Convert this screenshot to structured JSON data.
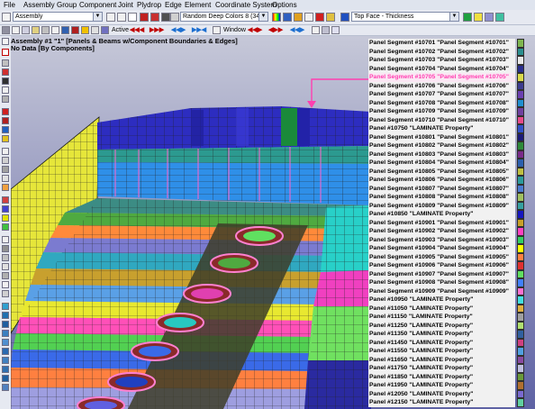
{
  "menu": [
    "File",
    "Assembly",
    "Group",
    "Component",
    "Joint",
    "Plydrop",
    "Edge",
    "Element",
    "Coordinate System",
    "Options"
  ],
  "toolbar": {
    "assembly_select": "Assembly",
    "color_scheme_select": "Random Deep Colors 8 (34)",
    "display_select": "Top Face - Thickness",
    "active_label": "Active",
    "window_label": "Window"
  },
  "viewport": {
    "title_line1": "Assembly #1 \"1\" [Panels & Beams w/Component Boundaries & Edges]",
    "title_line2": "No Data [By Components]"
  },
  "legend": [
    {
      "label": "Panel Segment #10701  \"Panel Segment #10701\"",
      "color": "#7fb64f"
    },
    {
      "label": "Panel Segment #10702  \"Panel Segment #10702\"",
      "color": "#2b8f8f"
    },
    {
      "label": "Panel Segment #10703  \"Panel Segment #10703\"",
      "color": "#e8e8e8"
    },
    {
      "label": "Panel Segment #10704  \"Panel Segment #10704\"",
      "color": "#2a2e8f"
    },
    {
      "label": "Panel Segment #10705  \"Panel Segment #10705\"",
      "color": "#d9d94a",
      "selected": true
    },
    {
      "label": "Panel Segment #10706  \"Panel Segment #10706\"",
      "color": "#3c3c90"
    },
    {
      "label": "Panel Segment #10707  \"Panel Segment #10707\"",
      "color": "#6a3fb0"
    },
    {
      "label": "Panel Segment #10708  \"Panel Segment #10708\"",
      "color": "#1f8fd0"
    },
    {
      "label": "Panel Segment #10709  \"Panel Segment #10709\"",
      "color": "#7040a0"
    },
    {
      "label": "Panel Segment #10710  \"Panel Segment #10710\"",
      "color": "#e84a8a"
    },
    {
      "label": "Panel #10750  \"LAMINATE Property\"",
      "color": "#3050c8"
    },
    {
      "label": "Panel Segment #10801  \"Panel Segment #10801\"",
      "color": "#1a1a7a"
    },
    {
      "label": "Panel Segment #10802  \"Panel Segment #10802\"",
      "color": "#2e8a3a"
    },
    {
      "label": "Panel Segment #10803  \"Panel Segment #10803\"",
      "color": "#7a2a8a"
    },
    {
      "label": "Panel Segment #10804  \"Panel Segment #10804\"",
      "color": "#2b5fae"
    },
    {
      "label": "Panel Segment #10805  \"Panel Segment #10805\"",
      "color": "#bfbf40"
    },
    {
      "label": "Panel Segment #10806  \"Panel Segment #10806\"",
      "color": "#2b9a9a"
    },
    {
      "label": "Panel Segment #10807  \"Panel Segment #10807\"",
      "color": "#4a7ad0"
    },
    {
      "label": "Panel Segment #10808  \"Panel Segment #10808\"",
      "color": "#a0c060"
    },
    {
      "label": "Panel Segment #10809  \"Panel Segment #10809\"",
      "color": "#35a0a0"
    },
    {
      "label": "Panel #10850  \"LAMINATE Property\"",
      "color": "#1515c0"
    },
    {
      "label": "Panel Segment #10901  \"Panel Segment #10901\"",
      "color": "#c8a028"
    },
    {
      "label": "Panel Segment #10902  \"Panel Segment #10902\"",
      "color": "#ff40c0"
    },
    {
      "label": "Panel Segment #10903  \"Panel Segment #10903\"",
      "color": "#30d060"
    },
    {
      "label": "Panel Segment #10904  \"Panel Segment #10904\"",
      "color": "#ffff00"
    },
    {
      "label": "Panel Segment #10905  \"Panel Segment #10905\"",
      "color": "#ff8040"
    },
    {
      "label": "Panel Segment #10906  \"Panel Segment #10906\"",
      "color": "#e03030"
    },
    {
      "label": "Panel Segment #10907  \"Panel Segment #10907\"",
      "color": "#60e060"
    },
    {
      "label": "Panel Segment #10908  \"Panel Segment #10908\"",
      "color": "#4080ff"
    },
    {
      "label": "Panel Segment #10909  \"Panel Segment #10909\"",
      "color": "#ff70d0"
    },
    {
      "label": "Panel #10950  \"LAMINATE Property\"",
      "color": "#40e0e0"
    },
    {
      "label": "Panel #11050  \"LAMINATE Property\"",
      "color": "#e0b040"
    },
    {
      "label": "Panel #11150  \"LAMINATE Property\"",
      "color": "#a0a0a0"
    },
    {
      "label": "Panel #11250  \"LAMINATE Property\"",
      "color": "#b0e070"
    },
    {
      "label": "Panel #11350  \"LAMINATE Property\"",
      "color": "#3060a0"
    },
    {
      "label": "Panel #11450  \"LAMINATE Property\"",
      "color": "#d04080"
    },
    {
      "label": "Panel #11550  \"LAMINATE Property\"",
      "color": "#50a0e0"
    },
    {
      "label": "Panel #11650  \"LAMINATE Property\"",
      "color": "#8a4aa0"
    },
    {
      "label": "Panel #11750  \"LAMINATE Property\"",
      "color": "#c0c0e0"
    },
    {
      "label": "Panel #11850  \"LAMINATE Property\"",
      "color": "#6a9a3a"
    },
    {
      "label": "Panel #11950  \"LAMINATE Property\"",
      "color": "#b07030"
    },
    {
      "label": "Panel #12050  \"LAMINATE Property\"",
      "color": "#7a6ad0"
    },
    {
      "label": "Panel #12150  \"LAMINATE Property\"",
      "color": "#60d0a0"
    }
  ]
}
